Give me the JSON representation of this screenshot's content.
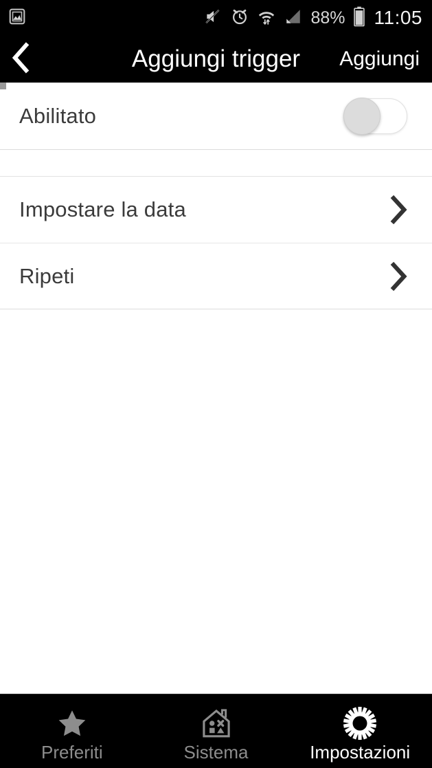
{
  "statusbar": {
    "left_icon": "gallery-image-icon",
    "icons": [
      "sound-muted-icon",
      "alarm-clock-icon",
      "wifi-data-transfer-icon",
      "cellular-signal-icon"
    ],
    "battery_percent": "88%",
    "battery_icon": "battery-icon",
    "time": "11:05"
  },
  "appbar": {
    "back_icon": "chevron-left-icon",
    "title": "Aggiungi trigger",
    "action_label": "Aggiungi"
  },
  "main": {
    "toggle_row": {
      "label": "Abilitato",
      "toggle_state": "off",
      "toggle_name": "enabled-toggle"
    },
    "rows": [
      {
        "label": "Impostare la data",
        "chevron": "chevron-right-icon"
      },
      {
        "label": "Ripeti",
        "chevron": "chevron-right-icon"
      }
    ]
  },
  "bottomnav": {
    "tabs": [
      {
        "label": "Preferiti",
        "icon": "star-icon",
        "active": false
      },
      {
        "label": "Sistema",
        "icon": "house-shapes-icon",
        "active": false
      },
      {
        "label": "Impostazioni",
        "icon": "gear-icon",
        "active": true
      }
    ]
  },
  "colors": {
    "bar_background": "#000000",
    "page_background": "#ffffff",
    "text_primary": "#3b3b3b",
    "tab_inactive": "#8d8d8d",
    "tab_active": "#ffffff",
    "divider": "#e2e2e2"
  }
}
